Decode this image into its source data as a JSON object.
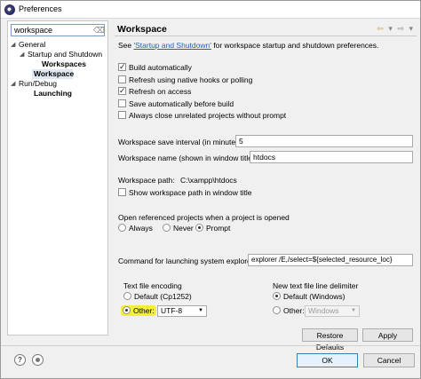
{
  "window": {
    "title": "Preferences"
  },
  "tree": {
    "filter_value": "workspace",
    "items": [
      {
        "label": "General"
      },
      {
        "label": "Startup and Shutdown"
      },
      {
        "label": "Workspaces"
      },
      {
        "label": "Workspace"
      },
      {
        "label": "Run/Debug"
      },
      {
        "label": "Launching"
      }
    ]
  },
  "page": {
    "title": "Workspace",
    "see_prefix": "See ",
    "see_link": "'Startup and Shutdown'",
    "see_suffix": " for workspace startup and shutdown preferences.",
    "checkboxes": [
      {
        "label": "Build automatically",
        "checked": true
      },
      {
        "label": "Refresh using native hooks or polling",
        "checked": false
      },
      {
        "label": "Refresh on access",
        "checked": true
      },
      {
        "label": "Save automatically before build",
        "checked": false
      },
      {
        "label": "Always close unrelated projects without prompt",
        "checked": false
      }
    ],
    "save_interval_label": "Workspace save interval (in minutes):",
    "save_interval_value": "5",
    "workspace_name_label": "Workspace name (shown in window title):",
    "workspace_name_value": "htdocs",
    "workspace_path_label": "Workspace path:",
    "workspace_path_value": "C:\\xampp\\htdocs",
    "show_path_label": "Show workspace path in window title",
    "open_projects_label": "Open referenced projects when a project is opened",
    "open_projects_options": [
      "Always",
      "Never",
      "Prompt"
    ],
    "launch_cmd_label": "Command for launching system explorer:",
    "launch_cmd_value": "explorer /E,/select=${selected_resource_loc}",
    "encoding_title": "Text file encoding",
    "encoding_default": "Default (Cp1252)",
    "encoding_other": "Other:",
    "encoding_other_value": "UTF-8",
    "delimiter_title": "New text file line delimiter",
    "delimiter_default": "Default (Windows)",
    "delimiter_other": "Other:",
    "delimiter_other_value": "Windows",
    "restore_defaults": "Restore Defaults",
    "apply": "Apply"
  },
  "footer": {
    "ok": "OK",
    "cancel": "Cancel"
  },
  "colors": {
    "highlight": "#f3ef3a",
    "link": "#2a5fb0",
    "selection": "#e0e8f2"
  },
  "icons": [
    "preferences-app-icon",
    "clear-filter-icon",
    "back-icon",
    "forward-icon",
    "help-icon",
    "import-export-icon"
  ]
}
